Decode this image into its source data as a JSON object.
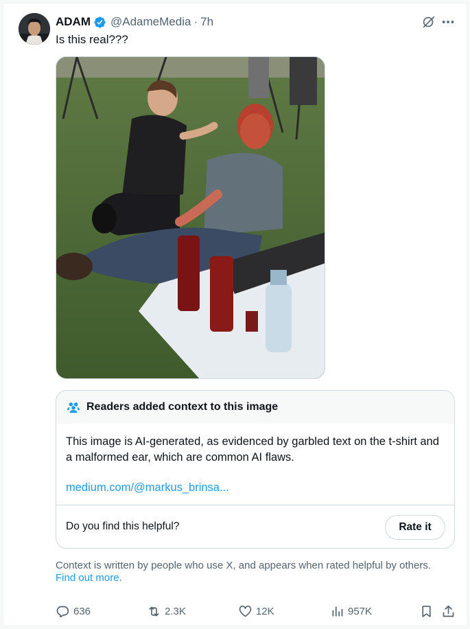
{
  "tweet": {
    "author_name": "ADAM",
    "handle": "@AdameMedia",
    "separator": "·",
    "time": "7h",
    "text": "Is this real???",
    "icons": {
      "verified": "verified-badge-icon",
      "grok": "grok-icon",
      "more": "more-icon"
    },
    "colors": {
      "accent": "#1d9bf0",
      "muted": "#536471"
    }
  },
  "community_note": {
    "title": "Readers added context to this image",
    "body": "This image is AI-generated, as evidenced by garbled text on the t-shirt and a malformed ear, which are common AI flaws.",
    "link": "medium.com/@markus_brinsa...",
    "question": "Do you find this helpful?",
    "rate_button": "Rate it"
  },
  "context_footer": {
    "text": "Context is written by people who use X, and appears when rated helpful by others.",
    "link": "Find out more",
    "period": "."
  },
  "actions": {
    "replies": "636",
    "reposts": "2.3K",
    "likes": "12K",
    "views": "957K"
  }
}
